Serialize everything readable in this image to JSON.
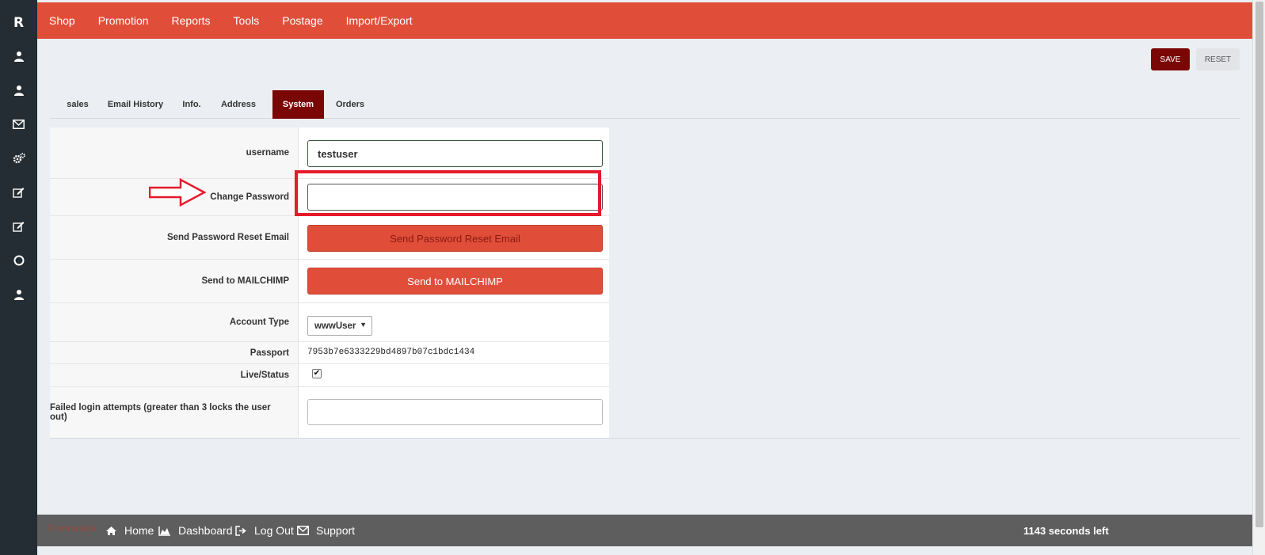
{
  "sidebar": {
    "logo": "R",
    "items": [
      {
        "icon": "user-icon"
      },
      {
        "icon": "user-icon"
      },
      {
        "icon": "envelope-icon"
      },
      {
        "icon": "cogs-icon"
      },
      {
        "icon": "edit-icon"
      },
      {
        "icon": "edit-icon"
      },
      {
        "icon": "circle-icon"
      },
      {
        "icon": "user-icon"
      }
    ]
  },
  "topnav": {
    "items": [
      "Shop",
      "Promotion",
      "Reports",
      "Tools",
      "Postage",
      "Import/Export"
    ]
  },
  "actions": {
    "save_label": "SAVE",
    "reset_label": "RESET"
  },
  "tabs": {
    "items": [
      "sales",
      "Email History",
      "Info.",
      "Address",
      "System",
      "Orders"
    ],
    "active": "System"
  },
  "form": {
    "username_label": "username",
    "username_value": "testuser",
    "change_password_label": "Change Password",
    "change_password_value": "",
    "reset_email_label": "Send Password Reset Email",
    "reset_email_button": "Send Password Reset Email",
    "mailchimp_label": "Send to MAILCHIMP",
    "mailchimp_button": "Send to MAILCHIMP",
    "account_type_label": "Account Type",
    "account_type_value": "wwwUser",
    "passport_label": "Passport",
    "passport_value": "7953b7e6333229bd4897b07c1bdc1434",
    "live_status_label": "Live/Status",
    "live_status_checked": true,
    "failed_login_label": "Failed login attempts (greater than 3 locks the user out)",
    "failed_login_value": ""
  },
  "footer": {
    "home": "Home",
    "dashboard": "Dashboard",
    "logout": "Log Out",
    "support": "Support",
    "timer": "1143 seconds left",
    "copyright": "© www.ade"
  },
  "colors": {
    "brand_red": "#e04e3a",
    "dark_red": "#7a0606",
    "sidebar": "#232d33",
    "highlight": "#e51a2b"
  }
}
